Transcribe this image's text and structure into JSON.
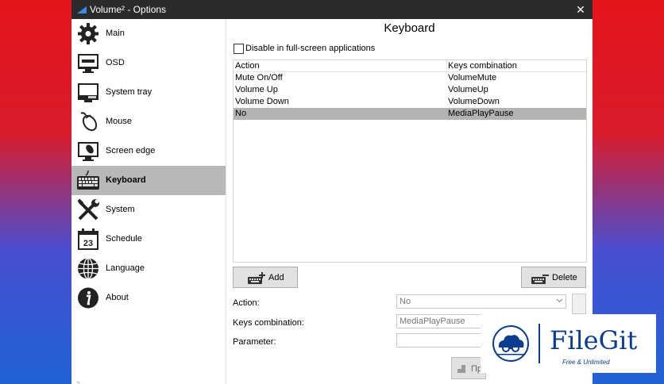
{
  "window": {
    "title": "Volume² - Options",
    "close_glyph": "✕"
  },
  "sidebar": {
    "items": [
      {
        "label": "Main",
        "icon": "gear-icon"
      },
      {
        "label": "OSD",
        "icon": "monitor-icon"
      },
      {
        "label": "System tray",
        "icon": "tray-icon"
      },
      {
        "label": "Mouse",
        "icon": "mouse-icon"
      },
      {
        "label": "Screen edge",
        "icon": "screen-edge-icon"
      },
      {
        "label": "Keyboard",
        "icon": "keyboard-icon",
        "active": true
      },
      {
        "label": "System",
        "icon": "tools-icon"
      },
      {
        "label": "Schedule",
        "icon": "calendar-icon",
        "day": "23"
      },
      {
        "label": "Language",
        "icon": "globe-icon"
      },
      {
        "label": "About",
        "icon": "info-icon"
      }
    ],
    "grip_text": "2"
  },
  "content": {
    "heading": "Keyboard",
    "disable_fullscreen_label": "Disable in full-screen applications",
    "table": {
      "headers": [
        "Action",
        "Keys combination"
      ],
      "rows": [
        [
          "Mute On/Off",
          "VolumeMute"
        ],
        [
          "Volume Up",
          "VolumeUp"
        ],
        [
          "Volume Down",
          "VolumeDown"
        ],
        [
          "No",
          "MediaPlayPause"
        ]
      ],
      "selected_row": 3
    },
    "add_label": "Add",
    "delete_label": "Delete",
    "form": {
      "action_label": "Action:",
      "action_value": "No",
      "keys_label": "Keys combination:",
      "keys_value": "MediaPlayPause",
      "parameter_label": "Parameter:",
      "parameter_value": ""
    },
    "bottom_button_label": "Пр"
  },
  "watermark": {
    "name": "FileGit",
    "tagline": "Free & Unlimited"
  },
  "colors": {
    "titlebar": "#2b2b2b",
    "selection": "#b8b8b8",
    "brand": "#0a3d8f"
  }
}
